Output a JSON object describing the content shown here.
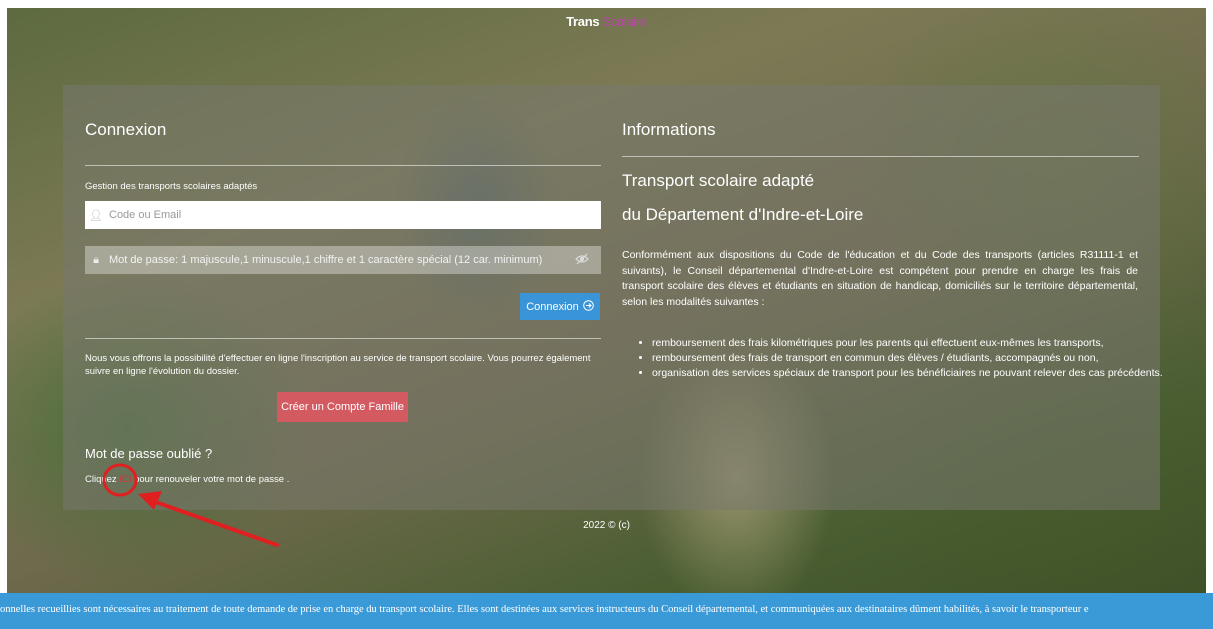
{
  "header": {
    "brand_part1": "Trans",
    "brand_part2": "Scolaire"
  },
  "login": {
    "title": "Connexion",
    "subtitle": "Gestion des transports scolaires adaptés",
    "code_placeholder": "Code ou Email",
    "password_placeholder": "Mot de passe: 1 majuscule,1 minuscule,1 chiffre et 1 caractère spécial (12 car. minimum)",
    "connect_label": "Connexion",
    "intro": "Nous vous offrons la possibilité d'effectuer en ligne l'inscription au service de transport scolaire. Vous pourrez également suivre en ligne l'évolution du dossier.",
    "create_account_label": "Créer un Compte Famille",
    "forgot_title": "Mot de passe oublié ?",
    "forgot_prefix": "Cliquez ",
    "forgot_link": "ICI",
    "forgot_suffix": " pour renouveler votre mot de passe ."
  },
  "info": {
    "title": "Informations",
    "heading_line1": "Transport scolaire adapté",
    "heading_line2": "du Département d'Indre-et-Loire",
    "paragraph": "Conformément aux dispositions du Code de l'éducation et du Code des transports (articles R31111-1 et suivants), le Conseil départemental d'Indre-et-Loire est compétent pour prendre en charge les frais de transport scolaire des élèves et étudiants en situation de handicap, domiciliés sur le territoire départemental, selon les modalités suivantes :",
    "bullets": [
      "remboursement des frais kilométriques pour les parents qui effectuent eux-mêmes les transports,",
      "remboursement des frais de transport en commun des élèves / étudiants, accompagnés ou non,",
      "organisation des services spéciaux de transport pour les bénéficiaires ne pouvant relever des cas précédents."
    ]
  },
  "footer": {
    "copyright": "2022 © (c)"
  },
  "banner": {
    "text": "onnelles recueillies sont nécessaires au traitement de toute demande de prise en charge du transport scolaire. Elles sont destinées aux services instructeurs du Conseil départemental, et communiquées aux destinataires dûment habilités, à savoir le transporteur e"
  },
  "colors": {
    "connect_button": "#3a95d8",
    "create_button": "#d45a62",
    "banner": "#3a9ad8",
    "brand_accent": "#c040b0",
    "annotation": "#e02020"
  }
}
